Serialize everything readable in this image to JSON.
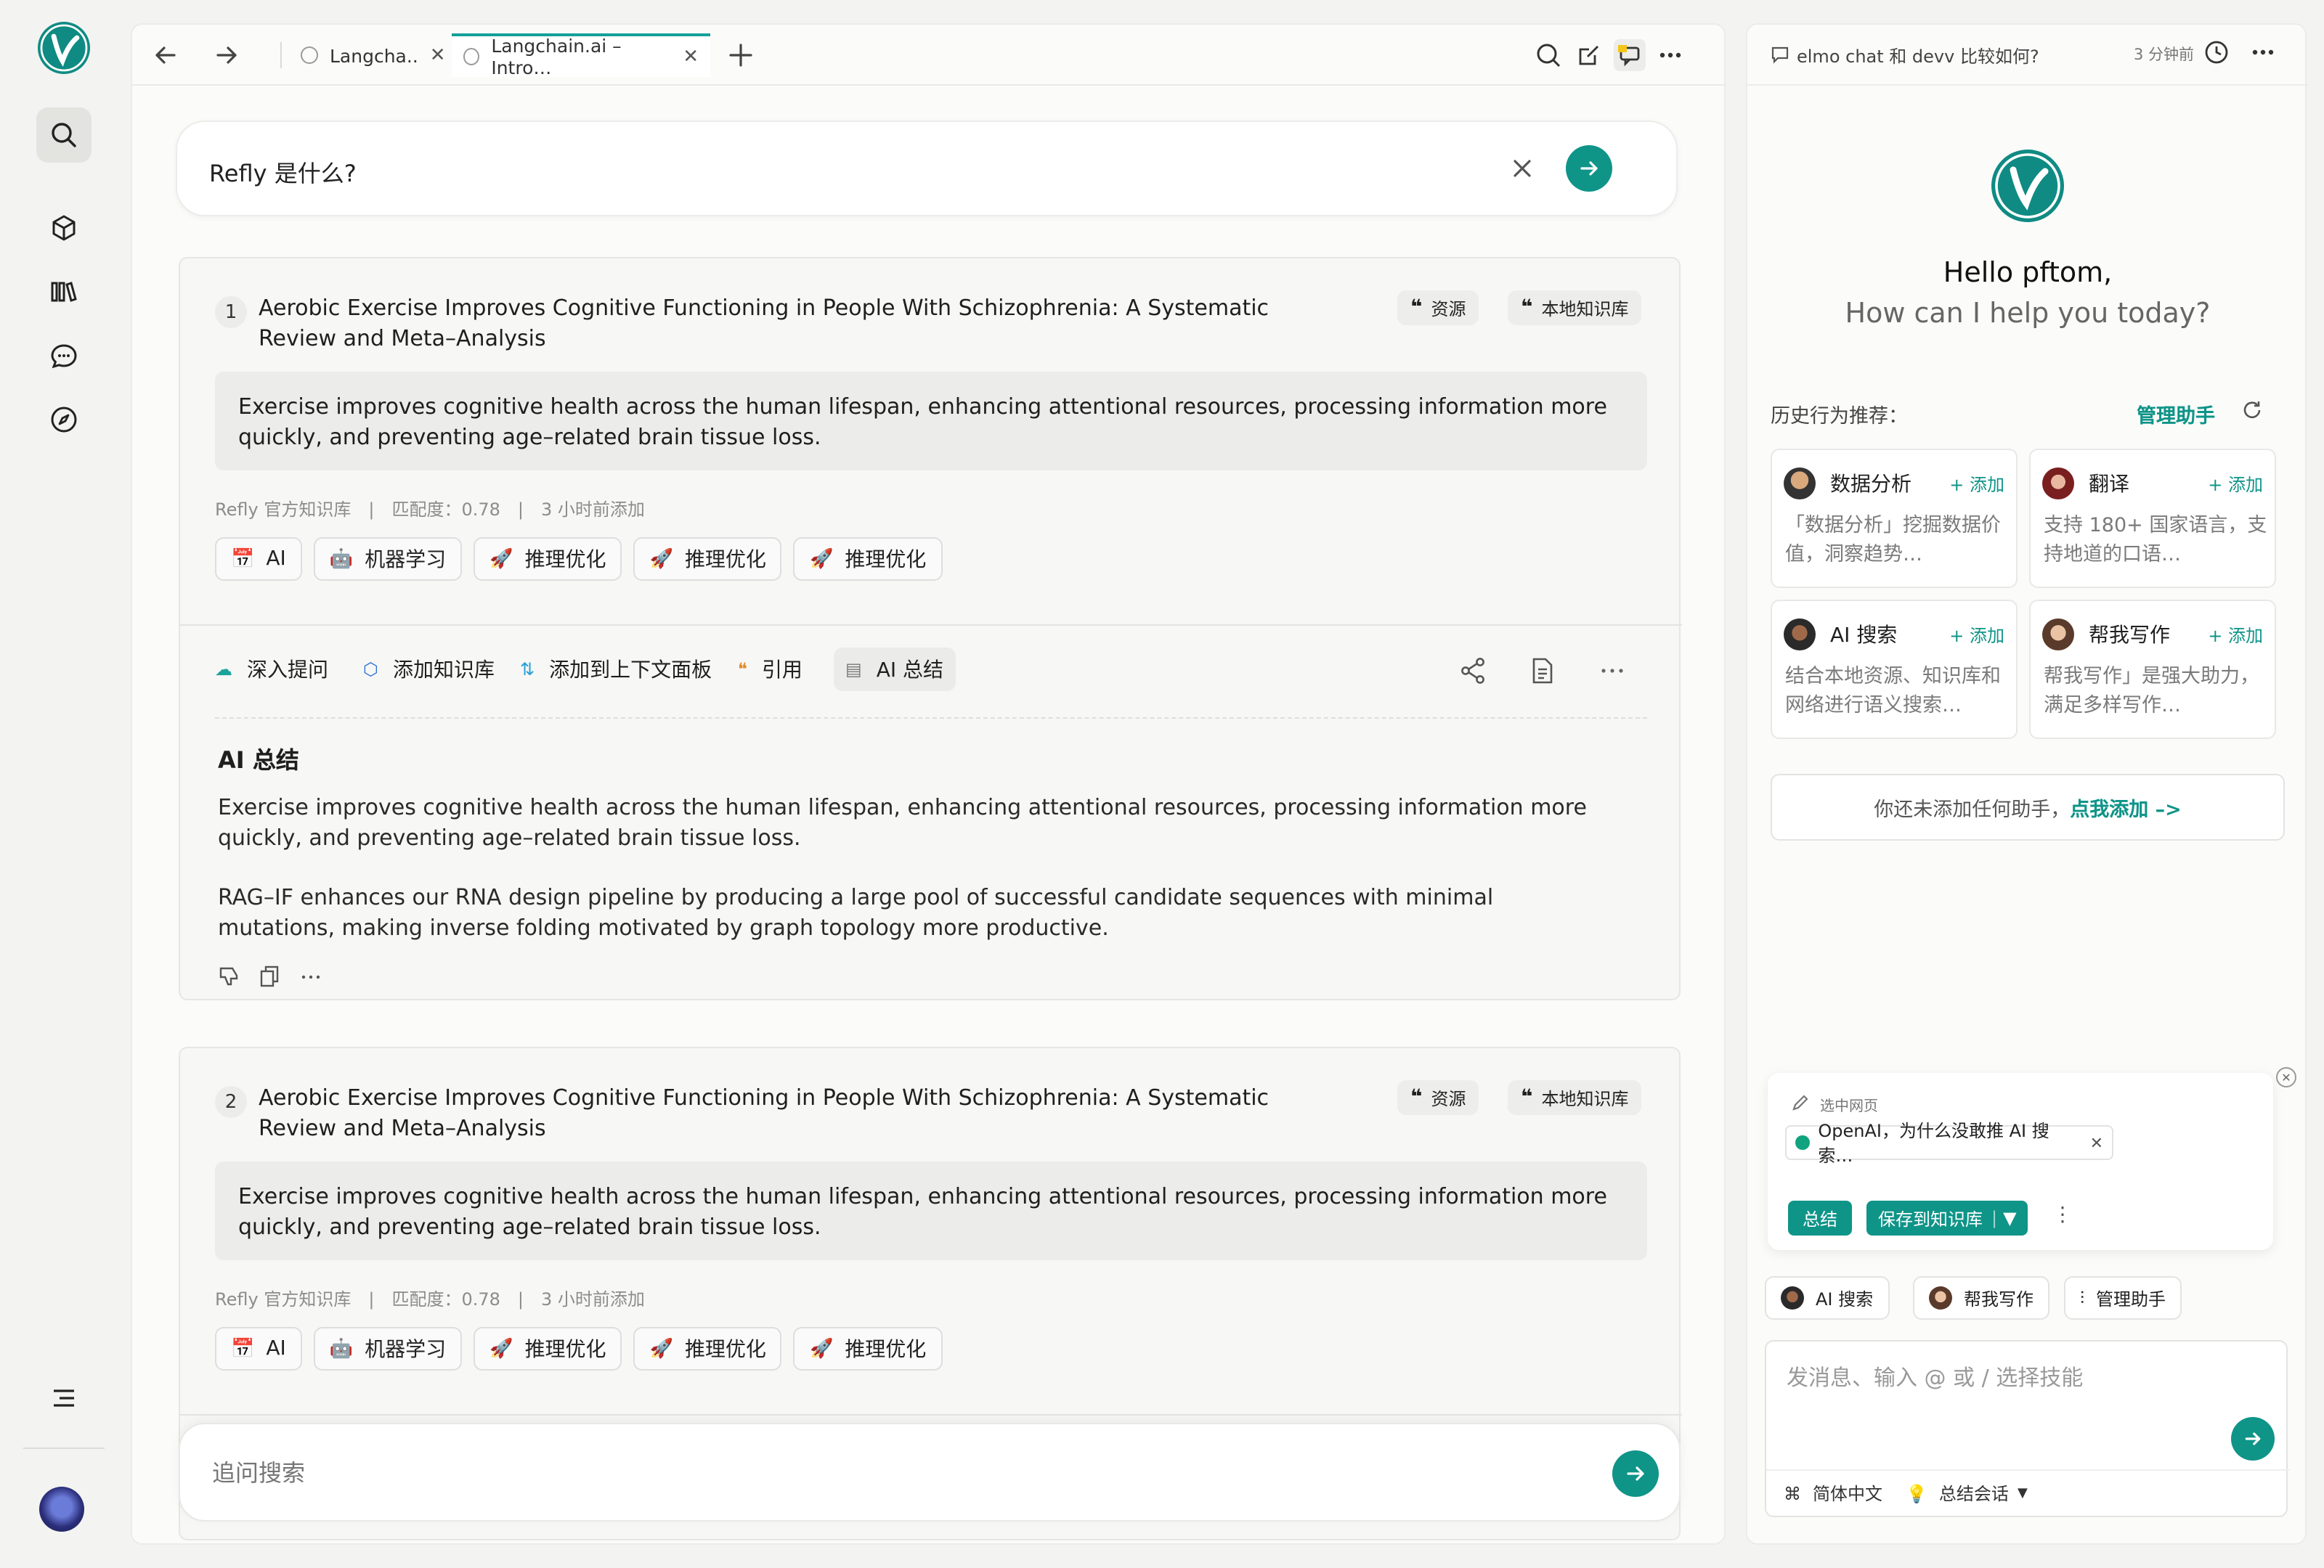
{
  "app": {
    "accent": "#0f9488"
  },
  "tabs": [
    {
      "label": "Langcha..",
      "active": false
    },
    {
      "label": "Langchain.ai – Intro…",
      "active": true
    }
  ],
  "search": {
    "query": "Refly 是什么?"
  },
  "results": [
    {
      "index": "1",
      "title": "Aerobic Exercise Improves Cognitive Functioning in People With Schizophrenia: A Systematic Review and Meta–Analysis",
      "badges": [
        "资源",
        "本地知识库"
      ],
      "quote": "Exercise improves cognitive health across the human lifespan, enhancing attentional resources, processing information more quickly, and preventing age–related brain tissue loss.",
      "meta": [
        "Refly 官方知识库",
        "匹配度：0.78",
        "3 小时前添加"
      ],
      "tags": [
        {
          "icon": "calendar",
          "label": "AI"
        },
        {
          "icon": "robot",
          "label": "机器学习"
        },
        {
          "icon": "rocket",
          "label": "推理优化"
        },
        {
          "icon": "rocket",
          "label": "推理优化"
        },
        {
          "icon": "rocket",
          "label": "推理优化"
        }
      ]
    },
    {
      "index": "2",
      "title": "Aerobic Exercise Improves Cognitive Functioning in People With Schizophrenia: A Systematic Review and Meta–Analysis",
      "badges": [
        "资源",
        "本地知识库"
      ],
      "quote": "Exercise improves cognitive health across the human lifespan, enhancing attentional resources, processing information more quickly, and preventing age–related brain tissue loss.",
      "meta": [
        "Refly 官方知识库",
        "匹配度：0.78",
        "3 小时前添加"
      ],
      "tags": [
        {
          "icon": "calendar",
          "label": "AI"
        },
        {
          "icon": "robot",
          "label": "机器学习"
        },
        {
          "icon": "rocket",
          "label": "推理优化"
        },
        {
          "icon": "rocket",
          "label": "推理优化"
        },
        {
          "icon": "rocket",
          "label": "推理优化"
        }
      ]
    }
  ],
  "actions": {
    "deep_ask": "深入提问",
    "add_kb": "添加知识库",
    "add_context": "添加到上下文面板",
    "cite": "引用",
    "ai_summary": "AI 总结"
  },
  "summary": {
    "title": "AI 总结",
    "paragraphs": [
      "Exercise improves cognitive health across the human lifespan, enhancing attentional resources, processing information more quickly, and preventing age–related brain tissue loss.",
      "RAG–IF enhances our RNA design pipeline by producing a large pool of successful candidate sequences with minimal mutations, making inverse folding motivated by graph topology more productive."
    ]
  },
  "follow": {
    "placeholder": "追问搜索"
  },
  "side": {
    "thread_title": "elmo chat 和 devv 比较如何?",
    "time": "3 分钟前",
    "hello": "Hello pftom,",
    "subtitle": "How can I help you today?",
    "history_label": "历史行为推荐：",
    "manage": "管理助手",
    "skills": [
      {
        "name": "数据分析",
        "add": "+ 添加",
        "desc": "「数据分析」挖掘数据价值，洞察趋势…"
      },
      {
        "name": "翻译",
        "add": "+ 添加",
        "desc": "支持 180+ 国家语言，支持地道的口语…"
      },
      {
        "name": "AI 搜索",
        "add": "+ 添加",
        "desc": "结合本地资源、知识库和网络进行语义搜索…"
      },
      {
        "name": "帮我写作",
        "add": "+ 添加",
        "desc": "帮我写作」是强大助力，满足多样写作…"
      }
    ],
    "no_skill_text": "你还未添加任何助手，",
    "no_skill_link": "点我添加 –>",
    "selected_label": "选中网页",
    "selected_page": "OpenAI，为什么没敢推 AI 搜索…",
    "btn_summary": "总结",
    "btn_save": "保存到知识库",
    "chips": [
      "AI 搜索",
      "帮我写作",
      "管理助手"
    ],
    "input_placeholder": "发消息、输入 @ 或 / 选择技能",
    "lang": "简体中文",
    "mode": "总结会话"
  }
}
